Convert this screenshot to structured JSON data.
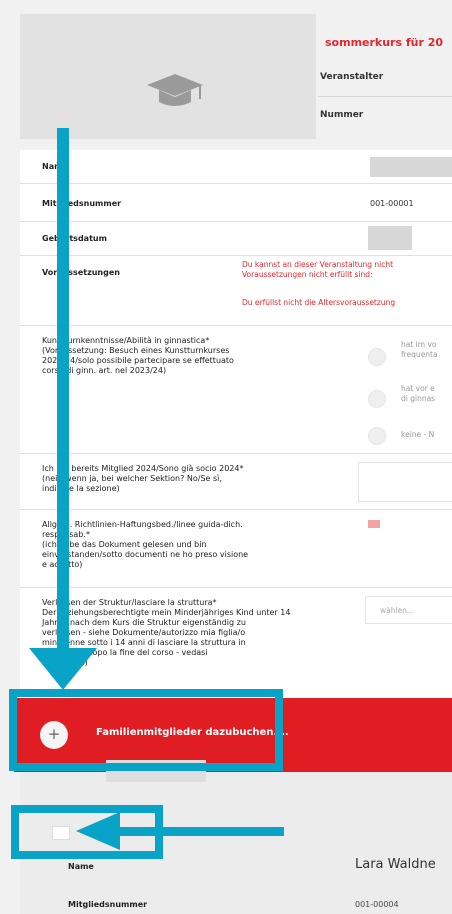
{
  "course": {
    "title": "sommerkurs für 20",
    "organizer_label": "Veranstalter",
    "number_label": "Nummer"
  },
  "member_form": {
    "name_label": "Name",
    "member_number_label": "Mitgliedsnummer",
    "member_number_value": "001-00001",
    "birthdate_label": "Geburtsdatum",
    "prerequisites_label": "Voraussetzungen",
    "error_1a": "Du kannst an dieser Veranstaltung nicht",
    "error_1b": "Voraussetzungen nicht erfüllt sind:",
    "error_2": "Du erfüllst nicht die Altersvoraussetzung",
    "q1_label_1": "Kunstturnkenntnisse/Abilità in ginnastica*",
    "q1_label_2": "(Voraussetzung: Besuch eines Kunstturnkurses",
    "q1_label_3": "2023/24/solo possibile partecipare se effettuato",
    "q1_label_4": "corso di ginn. art. nel 2023/24)",
    "q1_opt1_a": "hat im vo",
    "q1_opt1_b": "frequenta",
    "q1_opt2_a": "hat vor e",
    "q1_opt2_b": "di ginnas",
    "q1_opt3": "keine - N",
    "q2_label_1": "Ich bin bereits Mitglied 2024/Sono già socio 2024*",
    "q2_label_2": "(nein/wenn ja, bei welcher Sektion? No/Se sì,",
    "q2_label_3": "indicare la sezione)",
    "q3_label_1": "Allgem. Richtlinien-Haftungsbed./linee guida-dich.",
    "q3_label_2": "responsab.*",
    "q3_label_3": "(ich habe das Dokument gelesen und bin",
    "q3_label_4": "einverstanden/sotto documenti ne ho preso visione",
    "q3_label_5": "e accetto)",
    "q4_label_1": "Verlassen der Struktur/lasciare la struttura*",
    "q4_label_2": "Der Erziehungsberechtigte mein Minderjähriges Kind unter 14",
    "q4_label_3": "Jahren nach dem Kurs die Struktur eigenständig zu",
    "q4_label_4": "verlassen - siehe Dokumente/autorizzo mia figlia/o",
    "q4_label_5": "minorenne sotto i 14 anni di lasciare la struttura in",
    "q4_label_6": "autonomia dopo la fine del corso - vedasi",
    "q4_label_7": "documenti)",
    "q4_placeholder": "wählen..."
  },
  "add_family": {
    "plus": "+",
    "label": "Familienmitglieder dazubuchen...."
  },
  "family_member": {
    "name_label": "Name",
    "name_value": "Lara Waldne",
    "member_number_label": "Mitgliedsnummer",
    "member_number_value": "001-00004"
  },
  "colors": {
    "accent_red": "#e11d24",
    "annotation_blue": "#0aa3c8"
  }
}
